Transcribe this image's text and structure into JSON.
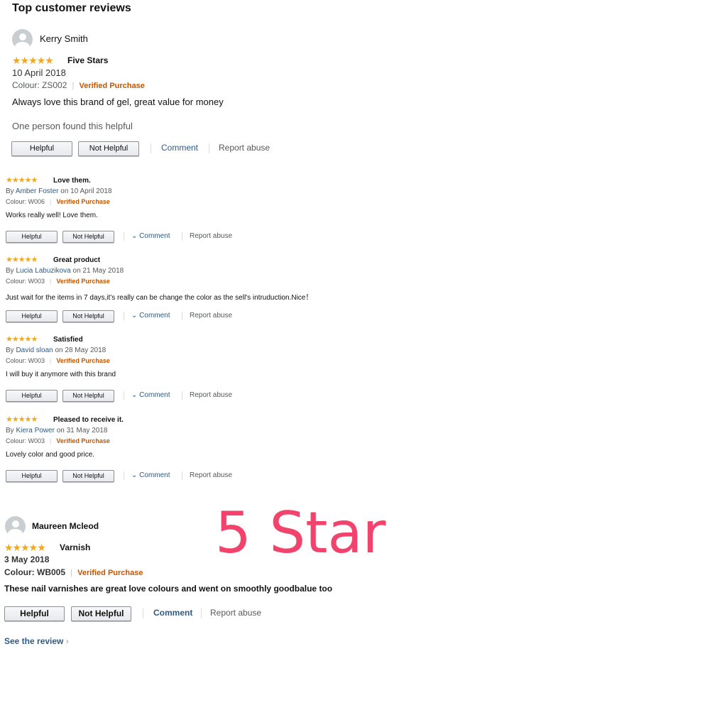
{
  "heading": "Top customer reviews",
  "colors": {
    "star": "#f0a81f",
    "link": "#2c5b88",
    "verified": "#c45500",
    "big_label": "#f2436d"
  },
  "stars_glyph": "★★★★★",
  "review1": {
    "author": "Kerry Smith",
    "rating": 5,
    "title": "Five Stars",
    "date": "10 April 2018",
    "colour": "Colour: ZS002",
    "verified": "Verified Purchase",
    "body": "Always love this brand of gel, great value for money",
    "helpful_count": "One person found this helpful",
    "helpful_label": "Helpful",
    "not_helpful_label": "Not Helpful",
    "comment_label": "Comment",
    "report_label": "Report abuse"
  },
  "compact_reviews": [
    {
      "rating": 5,
      "title": "Love them.",
      "by": "By",
      "author": "Amber Foster",
      "on_date": "on 10 April 2018",
      "colour": "Colour: W006",
      "verified": "Verified Purchase",
      "body": "Works really well! Love them.",
      "helpful_label": "Helpful",
      "not_helpful_label": "Not Helpful",
      "comment_label": "Comment",
      "report_label": "Report abuse"
    },
    {
      "rating": 5,
      "title": "Great product",
      "by": "By",
      "author": "Lucia Labuzikova",
      "on_date": "on 21 May 2018",
      "colour": "Colour: W003",
      "verified": "Verified Purchase",
      "body": "Just wait for the items in 7 days,it's really can be change the color as the sell's intruduction.Nice！",
      "helpful_label": "Helpful",
      "not_helpful_label": "Not Helpful",
      "comment_label": "Comment",
      "report_label": "Report abuse"
    },
    {
      "rating": 5,
      "title": "Satisfied",
      "by": "By",
      "author": "David sloan",
      "on_date": "on 28 May 2018",
      "colour": "Colour: W003",
      "verified": "Verified Purchase",
      "body": "I will buy it anymore with this brand",
      "helpful_label": "Helpful",
      "not_helpful_label": "Not Helpful",
      "comment_label": "Comment",
      "report_label": "Report abuse"
    },
    {
      "rating": 5,
      "title": "Pleased to receive it.",
      "by": "By",
      "author": "Kiera Power",
      "on_date": "on 31 May 2018",
      "colour": "Colour: W003",
      "verified": "Verified Purchase",
      "body": "Lovely color and good price.",
      "helpful_label": "Helpful",
      "not_helpful_label": "Not Helpful",
      "comment_label": "Comment",
      "report_label": "Report abuse"
    }
  ],
  "review_last": {
    "author": "Maureen Mcleod",
    "rating": 5,
    "title": "Varnish",
    "date": "3 May 2018",
    "colour": "Colour: WB005",
    "verified": "Verified Purchase",
    "body": "These nail varnishes are great love colours and went on smoothly goodbalue too",
    "helpful_label": "Helpful",
    "not_helpful_label": "Not Helpful",
    "comment_label": "Comment",
    "report_label": "Report abuse"
  },
  "big_label": "5 Star",
  "see_review": "See the review"
}
